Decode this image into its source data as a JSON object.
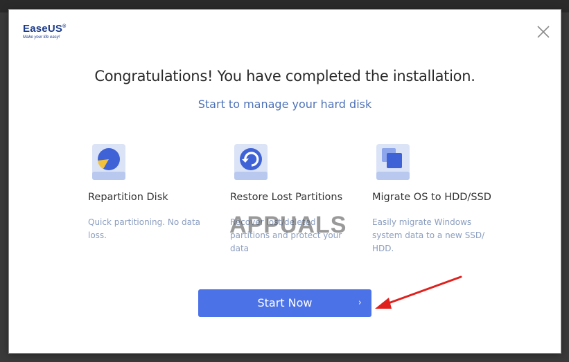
{
  "logo": {
    "brand": "EaseUS",
    "registered": "®",
    "tagline": "Make your life easy!"
  },
  "close": {
    "icon": "close-icon"
  },
  "heading": {
    "title": "Congratulations! You have completed the installation.",
    "subtitle": "Start to manage your hard disk"
  },
  "features": [
    {
      "icon": "pie-chart-disk-icon",
      "title": "Repartition Disk",
      "description": "Quick partitioning. No data loss."
    },
    {
      "icon": "restore-disk-icon",
      "title": "Restore Lost Partitions",
      "description": "Recover lost/deleted partitions and protect your data"
    },
    {
      "icon": "migrate-disk-icon",
      "title": "Migrate OS to HDD/SSD",
      "description": "Easily migrate Windows system data to a new SSD/ HDD."
    }
  ],
  "start_button": {
    "label": "Start Now",
    "chevron": "›"
  },
  "watermark": {
    "text": "APPUALS"
  },
  "colors": {
    "accent": "#4c72e8",
    "subtitle": "#4d72b8",
    "description": "#8a9dbf",
    "annotation_arrow": "#e0201c"
  }
}
